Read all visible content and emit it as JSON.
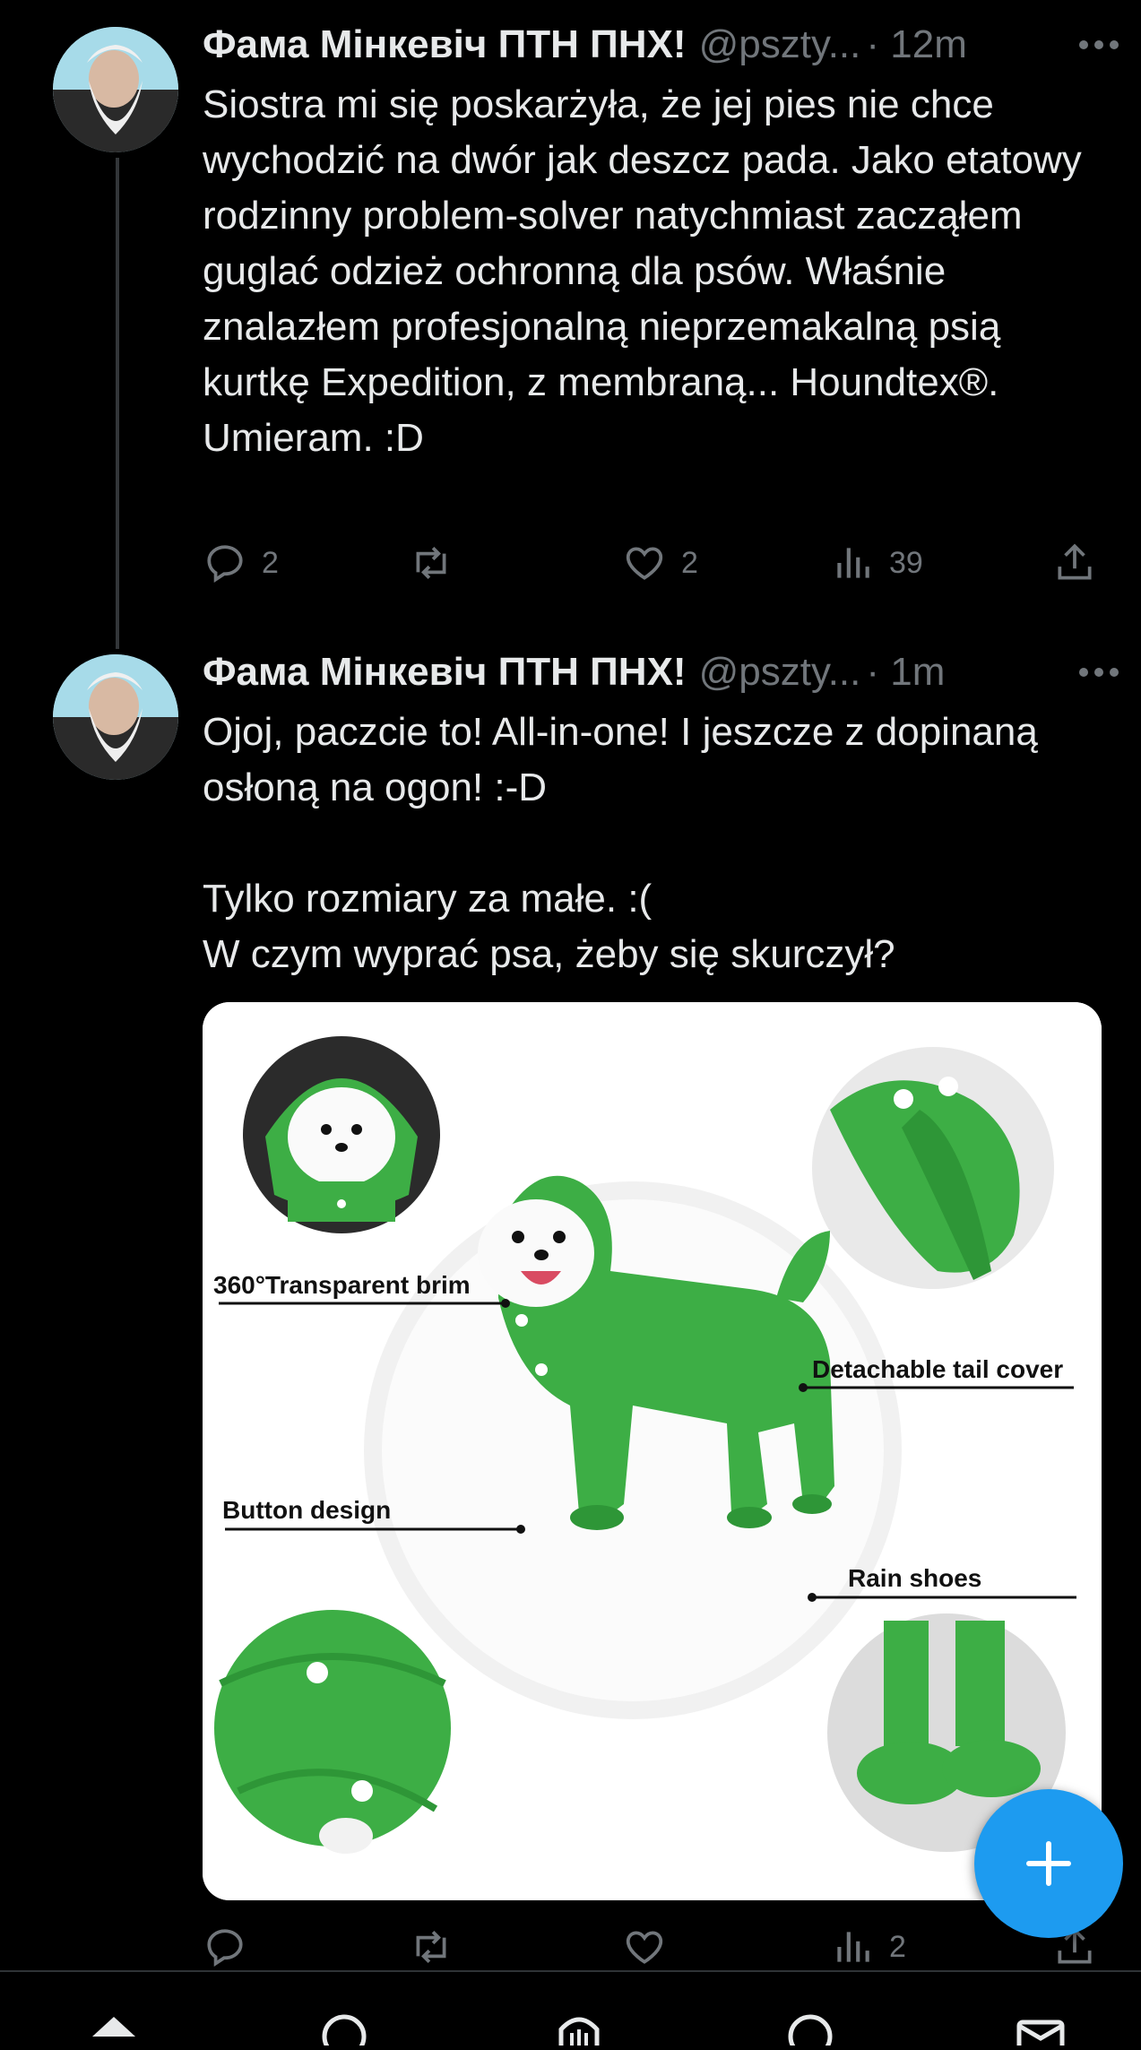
{
  "tweets": [
    {
      "name": "Фама Мінкевіч ПТН ПНХ!",
      "handle": "@pszty...",
      "time": "· 12m",
      "text": "Siostra mi się poskarżyła, że jej pies nie chce wychodzić na dwór jak deszcz pada. Jako etatowy rodzinny problem-solver natychmiast zacząłem guglać odzież ochronną dla psów. Właśnie znalazłem profesjonalną nieprzemakalną psią kurtkę Expedition, z membraną... Houndtex®.\nUmieram. :D",
      "replies": "2",
      "retweets": "",
      "likes": "2",
      "views": "39"
    },
    {
      "name": "Фама Мінкевіч ПТН ПНХ!",
      "handle": "@pszty...",
      "time": "· 1m",
      "text": "Ojoj, paczcie to! All-in-one! I jeszcze z dopinaną osłoną na ogon! :-D\n\nTylko rozmiary za małe. :(\nW czym wyprać psa, żeby się skurczył?",
      "replies": "",
      "retweets": "",
      "likes": "",
      "views": "2"
    }
  ],
  "media": {
    "labels": {
      "brim": "360°Transparent brim",
      "tail": "Detachable tail cover",
      "button": "Button design",
      "shoes": "Rain shoes"
    },
    "jacket_color": "#3dae45"
  },
  "icons": {
    "more": "more-icon",
    "reply": "reply-icon",
    "retweet": "retweet-icon",
    "like": "heart-icon",
    "views": "views-icon",
    "share": "share-icon",
    "compose": "plus-icon"
  },
  "colors": {
    "accent": "#1d9bf0",
    "muted": "#71767b",
    "text": "#e7e9ea"
  }
}
